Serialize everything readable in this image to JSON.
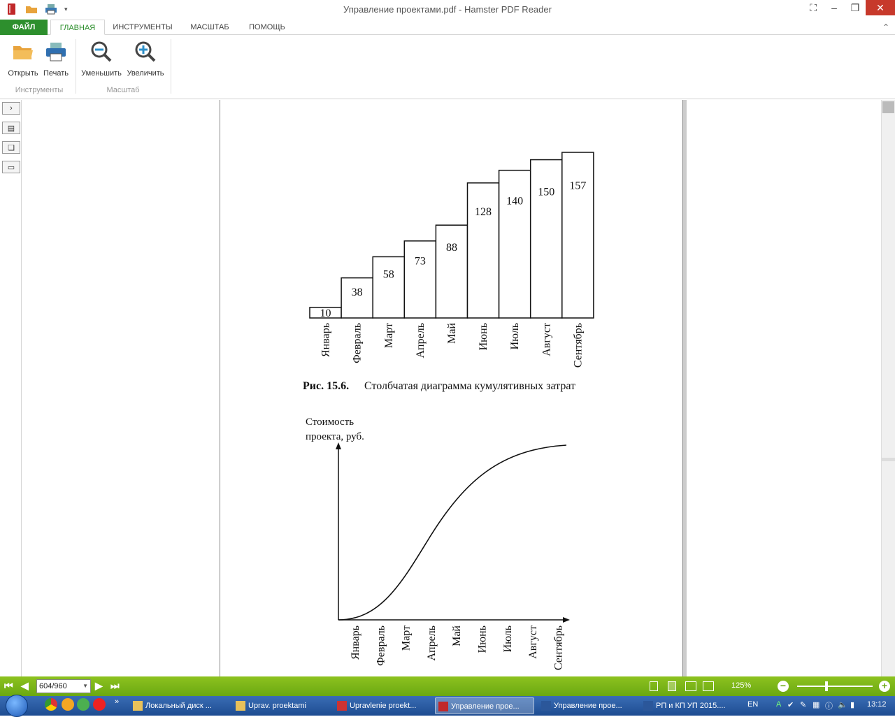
{
  "window": {
    "title": "Управление проектами.pdf - Hamster PDF Reader"
  },
  "tabs": [
    {
      "label": "ФАЙЛ"
    },
    {
      "label": "ГЛАВНАЯ"
    },
    {
      "label": "ИНСТРУМЕНТЫ"
    },
    {
      "label": "МАСШТАБ"
    },
    {
      "label": "ПОМОЩЬ"
    }
  ],
  "ribbon": {
    "open_label": "Открыть",
    "print_label": "Печать",
    "zoom_out_label": "Уменьшить",
    "zoom_in_label": "Увеличить",
    "group_tools": "Инструменты",
    "group_zoom": "Масштаб"
  },
  "chart_data": [
    {
      "type": "bar",
      "categories": [
        "Январь",
        "Февраль",
        "Март",
        "Апрель",
        "Май",
        "Июнь",
        "Июль",
        "Август",
        "Сентябрь"
      ],
      "values": [
        10,
        38,
        58,
        73,
        88,
        128,
        140,
        150,
        157
      ],
      "data_labels": [
        "10",
        "38",
        "58",
        "73",
        "88",
        "128",
        "140",
        "150",
        "157"
      ],
      "caption_prefix": "Рис. 15.6.",
      "caption": "Столбчатая диаграмма кумулятивных затрат"
    },
    {
      "type": "line",
      "categories": [
        "Январь",
        "Февраль",
        "Март",
        "Апрель",
        "Май",
        "Июнь",
        "Июль",
        "Август",
        "Сентябрь"
      ],
      "ylabel_line1": "Стоимость",
      "ylabel_line2": "проекта, руб.",
      "shape": "s-curve"
    }
  ],
  "statusbar": {
    "page_value": "604/960",
    "zoom": "125%"
  },
  "taskbar": {
    "tasks": [
      {
        "label": "Локальный диск ..."
      },
      {
        "label": "Uprav. proektami"
      },
      {
        "label": "Upravlenie proekt..."
      },
      {
        "label": "Управление прое..."
      },
      {
        "label": "Управление прое..."
      },
      {
        "label": "РП и КП  УП 2015...."
      }
    ],
    "lang": "EN",
    "time": "13:12"
  },
  "colors": {
    "accent": "#2d8f2d",
    "status_green": "#7fba00",
    "taskbar_blue": "#2a5aa0",
    "close_red": "#c7392b"
  }
}
